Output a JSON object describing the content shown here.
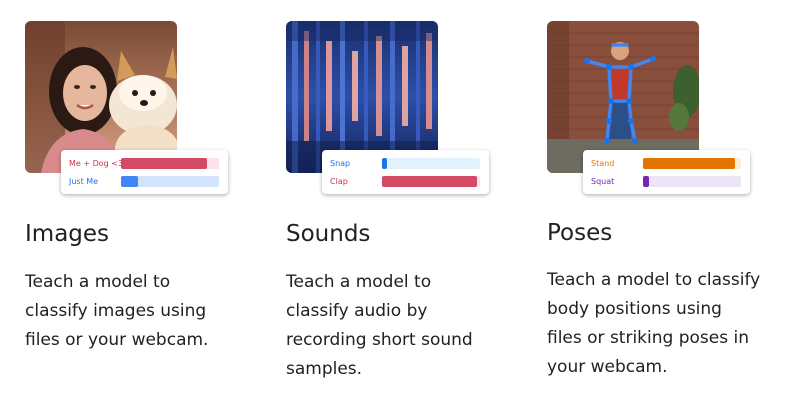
{
  "cards": [
    {
      "title": "Images",
      "description": "Teach a model to classify images using files or your webcam.",
      "classes": [
        {
          "label": "Me + Dog <3",
          "confidence": 0.88,
          "label_color": "#c8364f",
          "track_color": "#fbe2e7",
          "fill_color": "#d24a64"
        },
        {
          "label": "Just Me",
          "confidence": 0.17,
          "label_color": "#1a73e8",
          "track_color": "#d2e3fc",
          "fill_color": "#4285f4"
        }
      ]
    },
    {
      "title": "Sounds",
      "description": "Teach a model to classify audio by recording short sound samples.",
      "classes": [
        {
          "label": "Snap",
          "confidence": 0.05,
          "label_color": "#1a73e8",
          "track_color": "#e2f1fb",
          "fill_color": "#1a73e8"
        },
        {
          "label": "Clap",
          "confidence": 0.97,
          "label_color": "#c8364f",
          "track_color": "#fbe2e7",
          "fill_color": "#d24a64"
        }
      ]
    },
    {
      "title": "Poses",
      "description": "Teach a model to classify body positions using files or striking poses in your webcam.",
      "classes": [
        {
          "label": "Stand",
          "confidence": 0.94,
          "label_color": "#e37400",
          "track_color": "#fdebd3",
          "fill_color": "#e37400"
        },
        {
          "label": "Squat",
          "confidence": 0.06,
          "label_color": "#7627bb",
          "track_color": "#ede4f7",
          "fill_color": "#7627bb"
        }
      ]
    }
  ]
}
